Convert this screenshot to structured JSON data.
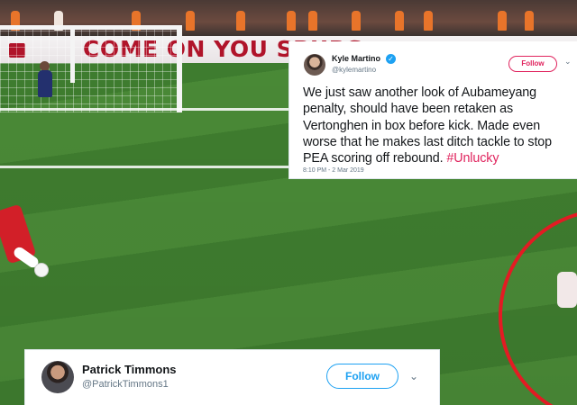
{
  "background": {
    "ad_board_text": "COME ON YOU SPURS"
  },
  "tweet_primary": {
    "name": "Kyle Martino",
    "handle": "@kylemartino",
    "follow_label": "Follow",
    "text": "We just saw another look of Aubameyang penalty, should have been retaken as Vertonghen in box before kick. Made even worse that he makes last ditch tackle to stop PEA scoring off rebound. ",
    "hashtag": "#Unlucky",
    "timestamp": "8:10 PM - 2 Mar 2019",
    "verified": true,
    "accent_color": "#e0245e"
  },
  "tweet_secondary": {
    "name": "Patrick Timmons",
    "handle": "@PatrickTimmons1",
    "follow_label": "Follow",
    "accent_color": "#1da1f2"
  },
  "annotation": {
    "circle_color": "#e31b23"
  },
  "icons": [
    "verified-icon",
    "chevron-down-icon",
    "avatar"
  ]
}
